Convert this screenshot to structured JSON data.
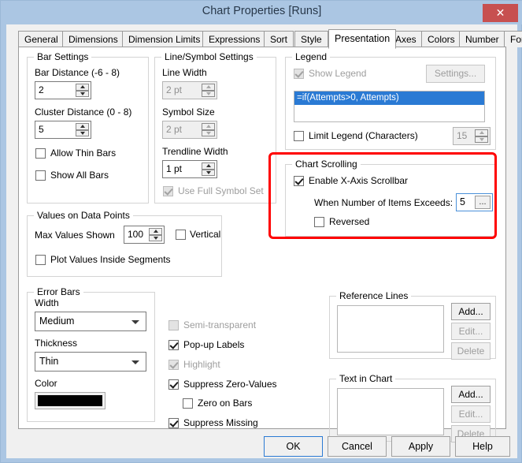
{
  "window": {
    "title": "Chart Properties [Runs]",
    "close_label": "✕",
    "accent_blue": "#2a7ad4",
    "titlebar_color": "#abc6e3",
    "close_color": "#c75050",
    "highlight_color": "#ff0000"
  },
  "tabs": {
    "items": [
      {
        "label": "General",
        "active": false
      },
      {
        "label": "Dimensions",
        "active": false
      },
      {
        "label": "Dimension Limits",
        "active": false
      },
      {
        "label": "Expressions",
        "active": false
      },
      {
        "label": "Sort",
        "active": false
      },
      {
        "label": "Style",
        "active": false
      },
      {
        "label": "Presentation",
        "active": true
      },
      {
        "label": "Axes",
        "active": false
      },
      {
        "label": "Colors",
        "active": false
      },
      {
        "label": "Number",
        "active": false
      },
      {
        "label": "Font",
        "active": false
      }
    ],
    "nav_prev": "◄",
    "nav_next": "►"
  },
  "bar_settings": {
    "title": "Bar Settings",
    "bar_distance_label": "Bar Distance (-6 - 8)",
    "bar_distance_value": "2",
    "cluster_distance_label": "Cluster Distance (0 - 8)",
    "cluster_distance_value": "5",
    "allow_thin_bars_label": "Allow Thin Bars",
    "allow_thin_bars_checked": false,
    "show_all_bars_label": "Show All Bars",
    "show_all_bars_checked": false
  },
  "line_symbol_settings": {
    "title": "Line/Symbol Settings",
    "line_width_label": "Line Width",
    "line_width_value": "2 pt",
    "line_width_disabled": true,
    "symbol_size_label": "Symbol Size",
    "symbol_size_value": "2 pt",
    "symbol_size_disabled": true,
    "trendline_width_label": "Trendline Width",
    "trendline_width_value": "1 pt",
    "trendline_width_disabled": false,
    "use_full_symbol_set_label": "Use Full Symbol Set",
    "use_full_symbol_set_checked": true,
    "use_full_symbol_set_disabled": true
  },
  "values_on_data_points": {
    "title": "Values on Data Points",
    "max_values_shown_label": "Max Values Shown",
    "max_values_shown_value": "100",
    "vertical_label": "Vertical",
    "vertical_checked": false,
    "plot_values_inside_segments_label": "Plot Values Inside Segments",
    "plot_values_inside_segments_checked": false
  },
  "error_bars": {
    "title": "Error Bars",
    "width_label": "Width",
    "width_value": "Medium",
    "thickness_label": "Thickness",
    "thickness_value": "Thin",
    "color_label": "Color",
    "color_value": "#000000"
  },
  "options_column": {
    "semi_transparent_label": "Semi-transparent",
    "semi_transparent_checked": false,
    "semi_transparent_disabled": true,
    "popup_labels_label": "Pop-up Labels",
    "popup_labels_checked": true,
    "highlight_label": "Highlight",
    "highlight_checked": true,
    "highlight_disabled": true,
    "suppress_zero_values_label": "Suppress Zero-Values",
    "suppress_zero_values_checked": true,
    "zero_on_bars_label": "Zero on Bars",
    "zero_on_bars_checked": false,
    "suppress_missing_label": "Suppress Missing",
    "suppress_missing_checked": true
  },
  "legend": {
    "title": "Legend",
    "show_legend_label": "Show Legend",
    "show_legend_checked": true,
    "show_legend_disabled": true,
    "settings_button": "Settings...",
    "settings_disabled": true,
    "items": [
      "=if(Attempts>0, Attempts)"
    ],
    "limit_legend_label": "Limit Legend (Characters)",
    "limit_legend_checked": false,
    "limit_legend_value": "15",
    "limit_legend_disabled": true
  },
  "chart_scrolling": {
    "title": "Chart Scrolling",
    "enable_scrollbar_label": "Enable X-Axis Scrollbar",
    "enable_scrollbar_checked": true,
    "items_exceed_label": "When Number of Items Exceeds:",
    "items_exceed_value": "5",
    "items_exceed_ellipsis": "...",
    "reversed_label": "Reversed",
    "reversed_checked": false
  },
  "reference_lines": {
    "title": "Reference Lines",
    "items": [],
    "add_label": "Add...",
    "edit_label": "Edit...",
    "delete_label": "Delete",
    "edit_disabled": true,
    "delete_disabled": true
  },
  "text_in_chart": {
    "title": "Text in Chart",
    "items": [],
    "add_label": "Add...",
    "edit_label": "Edit...",
    "delete_label": "Delete",
    "edit_disabled": true,
    "delete_disabled": true
  },
  "footer": {
    "ok_label": "OK",
    "cancel_label": "Cancel",
    "apply_label": "Apply",
    "help_label": "Help"
  }
}
